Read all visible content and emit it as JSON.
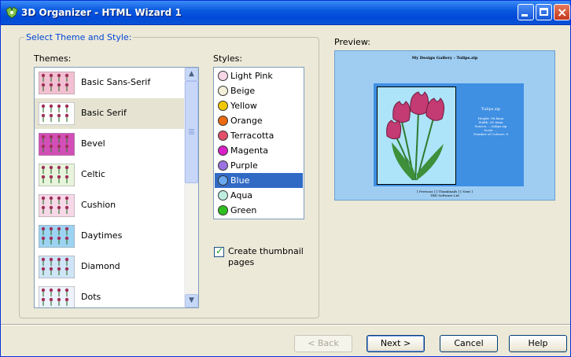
{
  "window": {
    "title": "3D Organizer - HTML Wizard 1"
  },
  "group": {
    "title": "Select Theme and Style:"
  },
  "themes": {
    "label": "Themes:",
    "items": [
      {
        "label": "Basic Sans-Serif",
        "selected": false,
        "thumb_color": "#f2c0d2"
      },
      {
        "label": "Basic Serif",
        "selected": true,
        "thumb_color": "#ffffff"
      },
      {
        "label": "Bevel",
        "selected": false,
        "thumb_color": "#d34fb8"
      },
      {
        "label": "Celtic",
        "selected": false,
        "thumb_color": "#e8f4dc"
      },
      {
        "label": "Cushion",
        "selected": false,
        "thumb_color": "#f6d8e8"
      },
      {
        "label": "Daytimes",
        "selected": false,
        "thumb_color": "#9dd3f2"
      },
      {
        "label": "Diamond",
        "selected": false,
        "thumb_color": "#cfe5f7"
      },
      {
        "label": "Dots",
        "selected": false,
        "thumb_color": "#eef2fb"
      }
    ]
  },
  "styles": {
    "label": "Styles:",
    "items": [
      {
        "label": "Light Pink",
        "color": "#f6d6e6",
        "selected": false
      },
      {
        "label": "Beige",
        "color": "#f3efd8",
        "selected": false
      },
      {
        "label": "Yellow",
        "color": "#f0c800",
        "selected": false
      },
      {
        "label": "Orange",
        "color": "#e96a10",
        "selected": false
      },
      {
        "label": "Terracotta",
        "color": "#e0506a",
        "selected": false
      },
      {
        "label": "Magenta",
        "color": "#d81fc8",
        "selected": false
      },
      {
        "label": "Purple",
        "color": "#9a72e0",
        "selected": false
      },
      {
        "label": "Blue",
        "color": "#6aa8f0",
        "selected": true
      },
      {
        "label": "Aqua",
        "color": "#bfeee0",
        "selected": false
      },
      {
        "label": "Green",
        "color": "#2fbf1f",
        "selected": false
      }
    ]
  },
  "thumbnail_option": {
    "label_line1": "Create thumbnail",
    "label_line2": "pages",
    "checked": true
  },
  "preview": {
    "label": "Preview:",
    "page_title": "My Design Gallery - Tulips.zip",
    "info_title": "Tulips.zip",
    "info_lines": [
      "Height: 98.4mm",
      "Width: 81.6mm",
      "Source: ...\\tulips.zip",
      "Scale: ...",
      "Number of Colours: 8"
    ],
    "footer_line1": "[ Previous ] [ Thumbnails ] [ Next ]",
    "footer_line2": "TBD Software Ltd"
  },
  "buttons": {
    "back": "< Back",
    "next": "Next >",
    "cancel": "Cancel",
    "help": "Help"
  },
  "colors": {
    "titlebar": "#0a5ae0",
    "selection": "#316ac5",
    "group_title": "#0046d5",
    "window_bg": "#ece9d8"
  }
}
